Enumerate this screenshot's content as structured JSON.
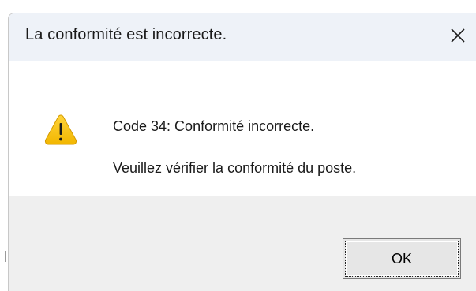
{
  "dialog": {
    "title": "La conformité est incorrecte.",
    "close_icon": "close-icon",
    "icon": "warning-icon",
    "message_line1": "Code 34: Conformité incorrecte.",
    "message_line2": "Veuillez vérifier la conformité du poste.",
    "ok_label": "OK"
  },
  "colors": {
    "titlebar_bg": "#eef2f8",
    "footer_bg": "#efefef",
    "warning_yellow": "#f5c400"
  }
}
